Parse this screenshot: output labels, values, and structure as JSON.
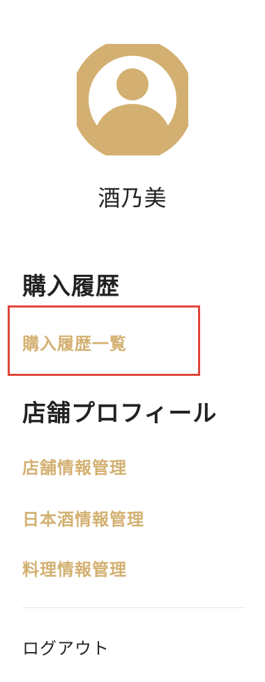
{
  "user": {
    "name": "酒乃美",
    "avatar_icon": "user-avatar-icon",
    "avatar_color": "#d3b071"
  },
  "sections": [
    {
      "heading": "購入履歴",
      "links": [
        "購入履歴一覧"
      ]
    },
    {
      "heading": "店舗プロフィール",
      "links": [
        "店舗情報管理",
        "日本酒情報管理",
        "料理情報管理"
      ]
    }
  ],
  "logout_label": "ログアウト",
  "colors": {
    "accent": "#d3b071",
    "highlight_border": "#e0463b",
    "text": "#222222"
  }
}
